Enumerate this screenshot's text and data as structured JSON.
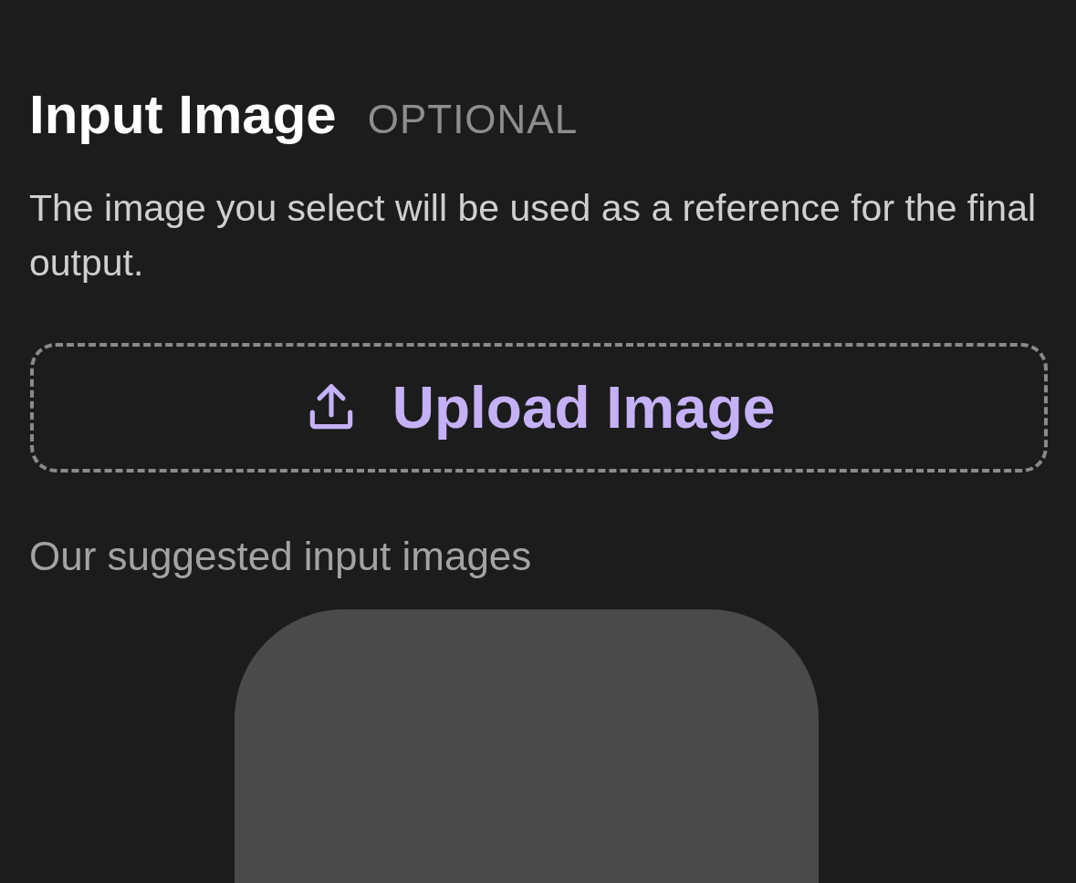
{
  "section": {
    "title": "Input Image",
    "badge": "OPTIONAL",
    "description": "The image you select will be used as a reference for the final output."
  },
  "upload": {
    "label": "Upload Image"
  },
  "suggestions": {
    "label": "Our suggested input images",
    "items": [
      {
        "kind": "placeholder"
      }
    ]
  }
}
